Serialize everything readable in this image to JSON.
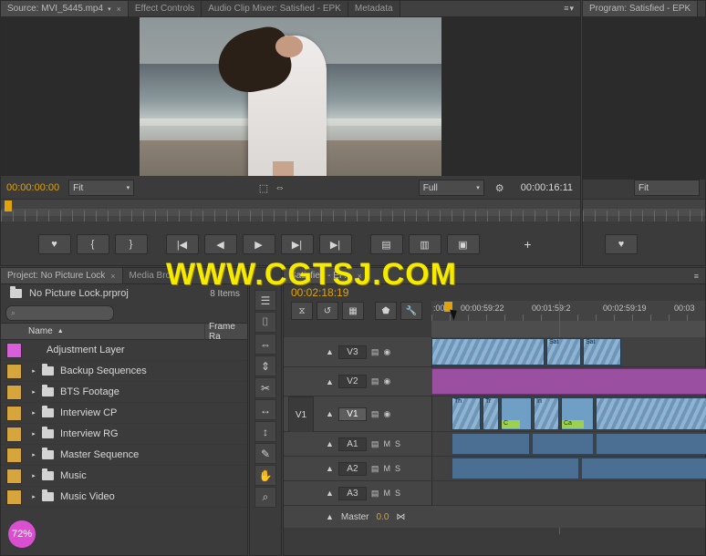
{
  "source_monitor": {
    "tabs": [
      {
        "label": "Source: MVI_5445.mp4",
        "caret": "▾",
        "active": true
      },
      {
        "label": "Effect Controls",
        "active": false
      },
      {
        "label": "Audio Clip Mixer: Satisfied - EPK",
        "active": false
      },
      {
        "label": "Metadata",
        "active": false
      }
    ],
    "close_glyph": "×",
    "menu_glyph": "≡▾",
    "timecode_left": "00:00:00:00",
    "timecode_right": "00:00:16:11",
    "fit_label": "Fit",
    "caret": "▾",
    "settings_icon": "⚙",
    "export_icon": "⬚",
    "markers_icon": "⇔",
    "buttons": [
      {
        "name": "add-marker-button",
        "glyph": "♥"
      },
      {
        "name": "mark-in-button",
        "glyph": "{"
      },
      {
        "name": "mark-out-button",
        "glyph": "}"
      },
      {
        "name": "go-to-in-button",
        "glyph": "|◀"
      },
      {
        "name": "step-back-button",
        "glyph": "◀"
      },
      {
        "name": "play-button",
        "glyph": "▶"
      },
      {
        "name": "step-forward-button",
        "glyph": "▶|"
      },
      {
        "name": "go-to-out-button",
        "glyph": "▶|"
      },
      {
        "name": "insert-button",
        "glyph": "▤"
      },
      {
        "name": "overwrite-button",
        "glyph": "▥"
      },
      {
        "name": "export-frame-button",
        "glyph": "▣"
      },
      {
        "name": "button-editor-button",
        "glyph": "+"
      }
    ]
  },
  "program_monitor": {
    "tab_label": "Program: Satisfied - EPK",
    "fit_label": "Fit",
    "button_glyph": "♥"
  },
  "project_panel": {
    "tabs": [
      {
        "label": "Project: No Picture Lock",
        "close": "×",
        "active": true
      },
      {
        "label": "Media Bro...",
        "active": false
      }
    ],
    "project_name": "No Picture Lock.prproj",
    "items_count": "8 Items",
    "search_placeholder": "",
    "search_icon": "⌕",
    "columns": [
      "Name",
      "Frame Ra"
    ],
    "sort_caret": "▲",
    "rows": [
      {
        "label": "Adjustment Layer",
        "color": "#d85fd8",
        "type": "item"
      },
      {
        "label": "Backup Sequences",
        "color": "#d6a63c",
        "type": "bin"
      },
      {
        "label": "BTS Footage",
        "color": "#d6a63c",
        "type": "bin"
      },
      {
        "label": "Interview CP",
        "color": "#d6a63c",
        "type": "bin"
      },
      {
        "label": "Interview RG",
        "color": "#d6a63c",
        "type": "bin"
      },
      {
        "label": "Master Sequence",
        "color": "#d6a63c",
        "type": "bin"
      },
      {
        "label": "Music",
        "color": "#d6a63c",
        "type": "bin"
      },
      {
        "label": "Music Video",
        "color": "#d6a63c",
        "type": "bin"
      }
    ],
    "badge_label": "72%"
  },
  "tools": [
    {
      "name": "track-select-tool",
      "glyph": "☰"
    },
    {
      "name": "ripple-edit-tool",
      "glyph": "⌷"
    },
    {
      "name": "rolling-edit-tool",
      "glyph": "⇔"
    },
    {
      "name": "rate-stretch-tool",
      "glyph": "⇕"
    },
    {
      "name": "razor-tool",
      "glyph": "✂"
    },
    {
      "name": "slip-tool",
      "glyph": "↔"
    },
    {
      "name": "slide-tool",
      "glyph": "↕"
    },
    {
      "name": "pen-tool",
      "glyph": "✎"
    },
    {
      "name": "hand-tool",
      "glyph": "✋"
    },
    {
      "name": "zoom-tool",
      "glyph": "⌕"
    }
  ],
  "timeline": {
    "tab_label": "Satisfied - EP...",
    "tab_close": "×",
    "playhead_timecode": "00:02:18:19",
    "ruler_labels": [
      ":00",
      "00:00:59:22",
      "00:01:59:2",
      "00:02:59:19",
      "00:03"
    ],
    "toolbar_buttons": [
      {
        "name": "snap-button",
        "glyph": "⧖"
      },
      {
        "name": "linked-selection-button",
        "glyph": "↺"
      },
      {
        "name": "add-marker-button",
        "glyph": "▦"
      },
      {
        "name": "marker-button",
        "glyph": "⬟"
      },
      {
        "name": "settings-button",
        "glyph": "🔧"
      }
    ],
    "tracks": [
      {
        "name": "V3",
        "kind": "video",
        "lock": "▲",
        "icons": [
          "▤",
          "◉"
        ]
      },
      {
        "name": "V2",
        "kind": "video",
        "lock": "▲",
        "icons": [
          "▤",
          "◉"
        ]
      },
      {
        "name": "V1",
        "kind": "video",
        "lock": "▲",
        "icons": [
          "▤",
          "◉"
        ],
        "group": "V1",
        "selected": true
      },
      {
        "name": "A1",
        "kind": "audio",
        "lock": "▲",
        "icons": [
          "▤"
        ],
        "mute": "M",
        "solo": "S"
      },
      {
        "name": "A2",
        "kind": "audio",
        "lock": "▲",
        "icons": [
          "▤"
        ],
        "mute": "M",
        "solo": "S"
      },
      {
        "name": "A3",
        "kind": "audio",
        "lock": "▲",
        "icons": [
          "▤"
        ],
        "mute": "M",
        "solo": "S"
      }
    ],
    "master_label": "Master",
    "master_value": "0.0",
    "master_icon": "⋈",
    "clip_labels": [
      "Sat",
      "Sat",
      "Th",
      "Tr",
      "In",
      "C",
      "Ca"
    ]
  },
  "watermark": "WWW.CGTSJ.COM",
  "colors": {
    "timecode_orange": "#e0a30c",
    "playhead_red": "#c83030",
    "watermark_yellow": "#f6ea00",
    "accent_magenta": "#d94fd0"
  }
}
